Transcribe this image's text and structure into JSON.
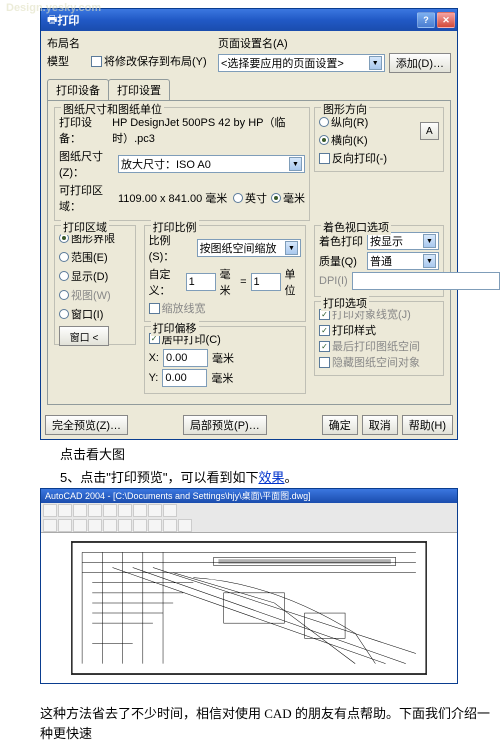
{
  "dialog": {
    "title": "打印",
    "top": {
      "layout_label": "布局名",
      "model": "模型",
      "save_layout_chk": "将修改保存到布局(Y)",
      "pageset_label": "页面设置名(A)",
      "pageset_value": "<选择要应用的页面设置>",
      "add_btn": "添加(D)…"
    },
    "tabs": {
      "t1": "打印设备",
      "t2": "打印设置"
    },
    "paper": {
      "group": "图纸尺寸和图纸单位",
      "device_label": "打印设备：",
      "device_value": "HP DesignJet 500PS 42 by HP（临时）.pc3",
      "size_label": "图纸尺寸(Z)：",
      "size_value": "放大尺寸：ISO A0",
      "area_label": "可打印区域：",
      "area_value": "1109.00 x 841.00 毫米",
      "u_in": "英寸",
      "u_mm": "毫米"
    },
    "orient": {
      "group": "图形方向",
      "o1": "纵向(R)",
      "o2": "横向(K)",
      "o3": "反向打印(-)"
    },
    "region": {
      "group": "打印区域",
      "r1": "图形界限",
      "r2": "范围(E)",
      "r3": "显示(D)",
      "r4": "视图(W)",
      "r5": "窗口(I)",
      "win_btn": "窗口 <"
    },
    "scale": {
      "group": "打印比例",
      "ratio_label": "比例(S)：",
      "ratio_value": "按图纸空间缩放",
      "custom": "自定义：",
      "v1": "1",
      "u1": "毫米",
      "eq": "=",
      "v2": "1",
      "u2": "单位",
      "lw": "缩放线宽"
    },
    "offset": {
      "group": "打印偏移",
      "center": "居中打印(C)",
      "xl": "X:",
      "xv": "0.00",
      "yl": "Y:",
      "yv": "0.00",
      "u": "毫米"
    },
    "shade": {
      "group": "着色视口选项",
      "sw_label": "着色打印",
      "sw_value": "按显示",
      "q_label": "质量(Q)",
      "q_value": "普通",
      "dpi_label": "DPI(I)"
    },
    "options": {
      "group": "打印选项",
      "o1": "打印对象线宽(J)",
      "o2": "打印样式",
      "o3": "最后打印图纸空间",
      "o4": "隐藏图纸空间对象"
    },
    "bottom": {
      "full": "完全预览(Z)…",
      "part": "局部预览(P)…",
      "ok": "确定",
      "cancel": "取消",
      "help": "帮助(H)"
    }
  },
  "text": {
    "click": "点击看大图",
    "step5a": "5、点击\"打印预览\"，可以看到如下",
    "step5b": "效果",
    "step5c": "。",
    "cad_title": "AutoCAD 2004 - [C:\\Documents and Settings\\hjy\\桌面\\平面图.dwg]",
    "footer": "这种方法省去了不少时间，相信对使用 CAD 的朋友有点帮助。下面我们介绍一种更快速"
  }
}
